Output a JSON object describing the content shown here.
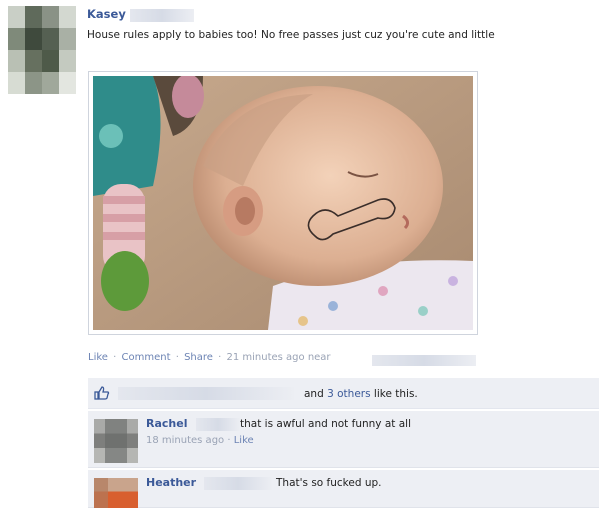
{
  "post": {
    "author": "Kasey",
    "text": "House rules apply to babies too! No free passes just cuz you're cute and little",
    "actions": {
      "like": "Like",
      "comment": "Comment",
      "share": "Share",
      "separator": "·",
      "time": "21 minutes ago near"
    }
  },
  "likes": {
    "prefix": "and",
    "count_link": "3 others",
    "suffix": "like this."
  },
  "comments": [
    {
      "name": "Rachel",
      "text": "that is awful and not funny at all",
      "time": "18 minutes ago",
      "like": "Like"
    },
    {
      "name": "Heather",
      "text": "That's so fucked up."
    }
  ],
  "colors": {
    "link_blue": "#3b5998",
    "ufi_bg": "#edeff4",
    "meta_gray": "#9aa3b5"
  },
  "icons": [
    "thumbs-up-icon"
  ]
}
